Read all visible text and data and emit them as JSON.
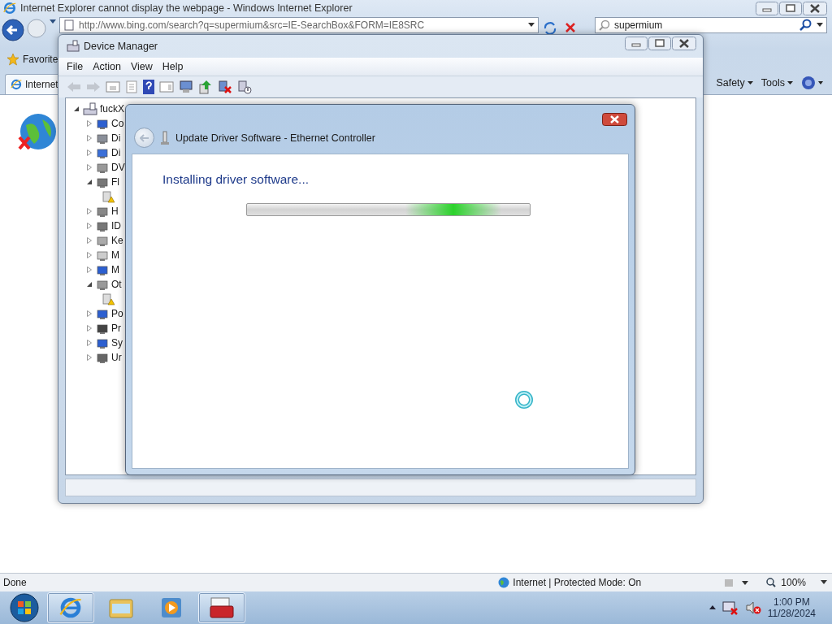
{
  "ie": {
    "title": "Internet Explorer cannot display the webpage - Windows Internet Explorer",
    "address": "http://www.bing.com/search?q=supermium&src=IE-SearchBox&FORM=IE8SRC",
    "search": "supermium",
    "favorites": "Favorite",
    "tab": "Internet",
    "commands": [
      "Safety",
      "Tools"
    ],
    "status": {
      "text": "Done",
      "zone": "Internet | Protected Mode: On",
      "zoom": "100%"
    }
  },
  "device_manager": {
    "title": "Device Manager",
    "menu": [
      "File",
      "Action",
      "View",
      "Help"
    ],
    "tree": {
      "label": "fuckX",
      "expanded": true,
      "children": [
        {
          "label": "Co",
          "expanded": false
        },
        {
          "label": "Di",
          "expanded": false
        },
        {
          "label": "Di",
          "expanded": false
        },
        {
          "label": "DV",
          "expanded": false
        },
        {
          "label": "Fl",
          "expanded": true,
          "children": [
            {
              "warning": true
            }
          ]
        },
        {
          "label": "H",
          "expanded": false
        },
        {
          "label": "ID",
          "expanded": false
        },
        {
          "label": "Ke",
          "expanded": false
        },
        {
          "label": "M",
          "expanded": false
        },
        {
          "label": "M",
          "expanded": false
        },
        {
          "label": "Ot",
          "expanded": true,
          "children": [
            {
              "warning": true
            }
          ]
        },
        {
          "label": "Po",
          "expanded": false
        },
        {
          "label": "Pr",
          "expanded": false
        },
        {
          "label": "Sy",
          "expanded": false
        },
        {
          "label": "Ur",
          "expanded": false
        }
      ]
    }
  },
  "dialog": {
    "title": "Update Driver Software - Ethernet Controller",
    "heading": "Installing driver software..."
  },
  "taskbar": {
    "apps": [
      {
        "kind": "ie",
        "running": true
      },
      {
        "kind": "folder",
        "running": false
      },
      {
        "kind": "media",
        "running": false
      },
      {
        "kind": "toolbox",
        "running": true
      }
    ],
    "time": "1:00 PM",
    "date": "11/28/2024"
  }
}
